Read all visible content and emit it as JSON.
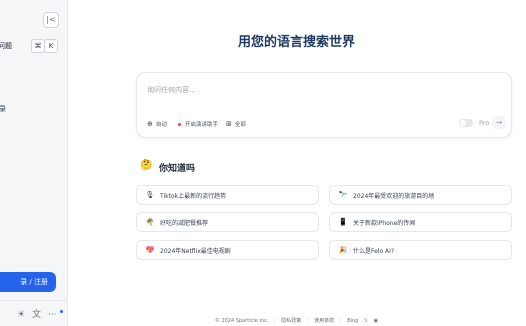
{
  "sidebar": {
    "collapse_glyph": "|<",
    "search_text": "问题",
    "shortcut_keys": [
      "⌘",
      "K"
    ],
    "fragment_text": "录",
    "login_label": "录 / 注册",
    "bottom_icons": [
      "sun-icon",
      "translate-icon",
      "more-icon"
    ]
  },
  "main": {
    "title": "用您的语言搜索世界",
    "search": {
      "placeholder": "询问任何内容...",
      "options": [
        {
          "icon": "globe-icon",
          "glyph": "⊕",
          "label": "自动"
        },
        {
          "icon": "red-dot",
          "glyph": "",
          "label": "开启演讲助手"
        },
        {
          "icon": "grid-icon",
          "glyph": "⊞",
          "label": "全部"
        }
      ],
      "pro_label": "Pro",
      "send_glyph": "→"
    },
    "did_you_know": {
      "icon": "🤔",
      "title": "你知道吗",
      "items": [
        {
          "icon": "🎙",
          "text": "Tiktok上最新的流行趋势"
        },
        {
          "icon": "🔭",
          "text": "2024年最受欢迎的旅游目的地"
        },
        {
          "icon": "🌴",
          "text": "好吃的减肥餐推荐"
        },
        {
          "icon": "📱",
          "text": "关于新款iPhone的传闻"
        },
        {
          "icon": "💖",
          "text": "2024年Netflix最佳电视剧"
        },
        {
          "icon": "🎉",
          "text": "什么是Felo AI?"
        }
      ]
    },
    "footer": {
      "copyright": "© 2024 Sparticle Inc.",
      "privacy": "隐私政策",
      "terms": "使用条款",
      "blog": "Blog",
      "x_glyph": "𝕏",
      "discord_glyph": "▣"
    }
  }
}
